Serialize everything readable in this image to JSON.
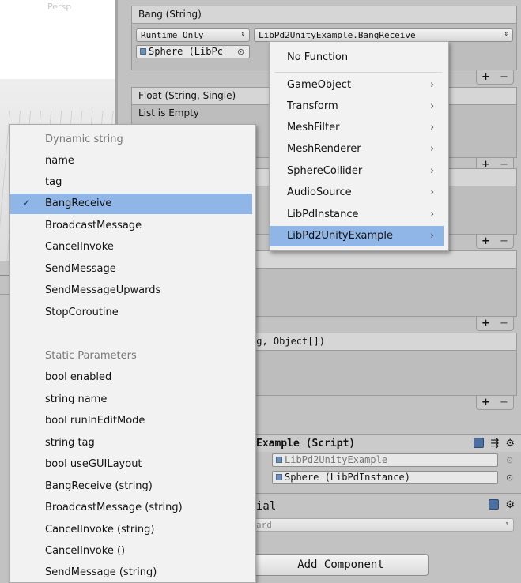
{
  "scene": {
    "view_label": "Persp"
  },
  "events": [
    {
      "header": "Bang (String)",
      "runtime_select": "Runtime Only",
      "function_select": "LibPd2UnityExample.BangReceive",
      "object_field": "Sphere (LibPc"
    },
    {
      "header": "Float (String, Single)",
      "empty_text": "List is Empty"
    },
    {
      "header": ""
    },
    {
      "header": ""
    },
    {
      "header": "ng, Object[])"
    }
  ],
  "footer_buttons": {
    "plus": "+",
    "minus": "−"
  },
  "component": {
    "title": "Example (Script)",
    "script_field": "LibPd2UnityExample",
    "instance_field": "Sphere (LibPdInstance)"
  },
  "material": {
    "title": "ial",
    "shader_select": "ard"
  },
  "add_component_label": "Add Component",
  "function_menu": {
    "no_function": "No Function",
    "items": [
      "GameObject",
      "Transform",
      "MeshFilter",
      "MeshRenderer",
      "SphereCollider",
      "AudioSource",
      "LibPdInstance",
      "LibPd2UnityExample"
    ],
    "highlighted": "LibPd2UnityExample"
  },
  "method_menu": {
    "dynamic_header": "Dynamic string",
    "dynamic_items": [
      "name",
      "tag",
      "BangReceive",
      "BroadcastMessage",
      "CancelInvoke",
      "SendMessage",
      "SendMessageUpwards",
      "StopCoroutine"
    ],
    "selected": "BangReceive",
    "static_header": "Static Parameters",
    "static_items": [
      "bool enabled",
      "string name",
      "bool runInEditMode",
      "string tag",
      "bool useGUILayout",
      "BangReceive (string)",
      "BroadcastMessage (string)",
      "CancelInvoke (string)",
      "CancelInvoke ()",
      "SendMessage (string)"
    ]
  },
  "icons": {
    "checkmark": "check-icon",
    "submenu": "chevron-right-icon",
    "object_target": "object-picker-icon",
    "help": "book-icon",
    "settings": "gear-icon",
    "layout": "preset-icon"
  },
  "colors": {
    "highlight": "#8fb6e6",
    "menu_bg": "#f2f2f2",
    "inspector_bg": "#c2c2c2"
  }
}
